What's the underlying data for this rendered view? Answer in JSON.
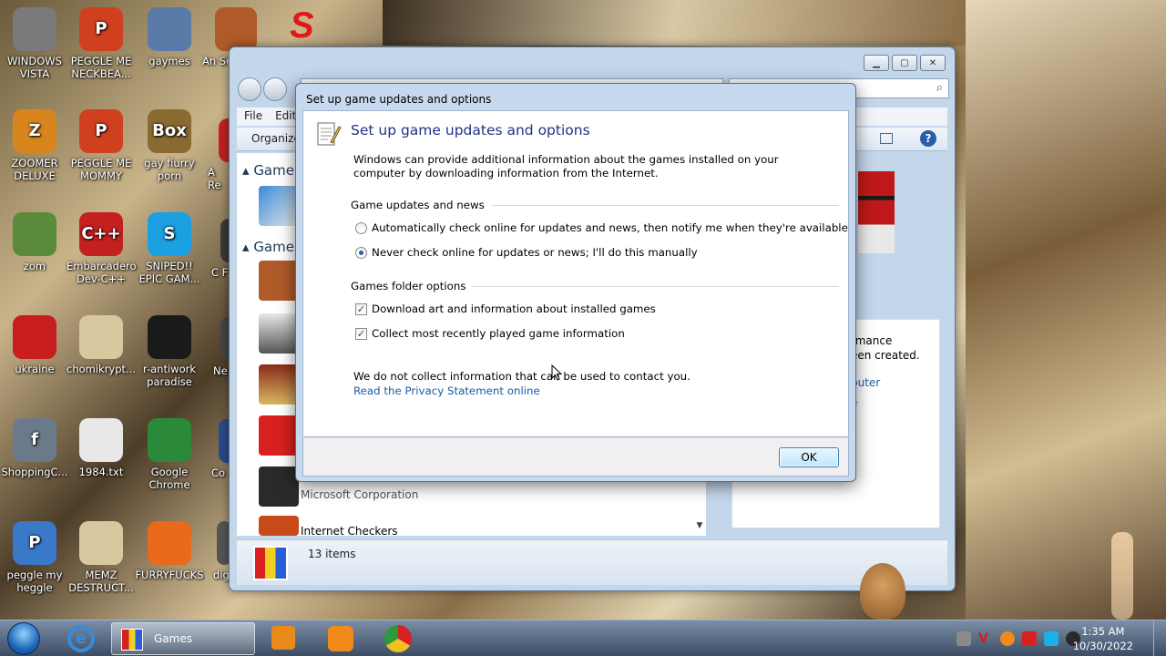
{
  "desktop_icons": [
    {
      "label": "WINDOWS VISTA",
      "color": "#7a7a7a",
      "glyph": ""
    },
    {
      "label": "PEGGLE ME NECKBEA...",
      "color": "#d0401e",
      "glyph": "P"
    },
    {
      "label": "gaymes",
      "color": "#5a7aa8",
      "glyph": ""
    },
    {
      "label": "ZOOMER DELUXE",
      "color": "#d8861c",
      "glyph": "Z"
    },
    {
      "label": "PEGGLE ME MOMMY",
      "color": "#d0401e",
      "glyph": "P"
    },
    {
      "label": "gay fiurry porn",
      "color": "#8a6a30",
      "glyph": "Box"
    },
    {
      "label": "zom",
      "color": "#5a8a3a",
      "glyph": ""
    },
    {
      "label": "Embarcadero Dev-C++",
      "color": "#c42020",
      "glyph": "C++"
    },
    {
      "label": "SNIPED!! EPIC GAM...",
      "color": "#1ba0e2",
      "glyph": "S"
    },
    {
      "label": "ukraine",
      "color": "#c81e1e",
      "glyph": ""
    },
    {
      "label": "chomikrypt...",
      "color": "#d8c8a0",
      "glyph": ""
    },
    {
      "label": "r-antiwork paradise",
      "color": "#1a1a1a",
      "glyph": ""
    },
    {
      "label": "ShoppingC...",
      "color": "#6a7a8a",
      "glyph": "f"
    },
    {
      "label": "1984.txt",
      "color": "#e8e8e8",
      "glyph": ""
    },
    {
      "label": "Google Chrome",
      "color": "#2a8a3a",
      "glyph": ""
    },
    {
      "label": "peggle my heggle",
      "color": "#3a78c8",
      "glyph": "P"
    },
    {
      "label": "MEMZ DESTRUCT...",
      "color": "#d8c8a0",
      "glyph": ""
    },
    {
      "label": "FURRYFUCKS",
      "color": "#e86a1a",
      "glyph": ""
    }
  ],
  "partial_icons": [
    {
      "label": "An Se"
    },
    {
      "label": "A Re"
    },
    {
      "label": "C F"
    },
    {
      "label": "Ne"
    },
    {
      "label": "Co"
    },
    {
      "label": "dig"
    }
  ],
  "explorer": {
    "menu": [
      "File",
      "Edit"
    ],
    "organize_label": "Organize",
    "group_game": "Game",
    "group_games": "Games",
    "publisher": "Microsoft Corporation",
    "last_item": "Internet Checkers",
    "status_count": "13 items",
    "right_text_1": "rmance",
    "right_text_2": "een created.",
    "right_link_1": "puter",
    "right_link_2": "e"
  },
  "dialog": {
    "window_title": "Set up game updates and options",
    "heading": "Set up game updates and options",
    "description": "Windows can provide additional information about the games installed on your computer by downloading information from the Internet.",
    "section_updates": "Game updates and news",
    "radio_auto": "Automatically check online for updates and news, then notify me when they're available",
    "radio_never": "Never check online for updates or news; I'll do this manually",
    "radio_selected": "never",
    "section_folder": "Games folder options",
    "check_download": "Download art and information about installed games",
    "check_download_checked": true,
    "check_collect": "Collect most recently played game information",
    "check_collect_checked": true,
    "privacy_note": "We do not collect information that can be used to contact you.",
    "privacy_link": "Read the Privacy Statement online",
    "ok_label": "OK"
  },
  "taskbar": {
    "active_window": "Games",
    "time": "1:35 AM",
    "date": "10/30/2022"
  }
}
